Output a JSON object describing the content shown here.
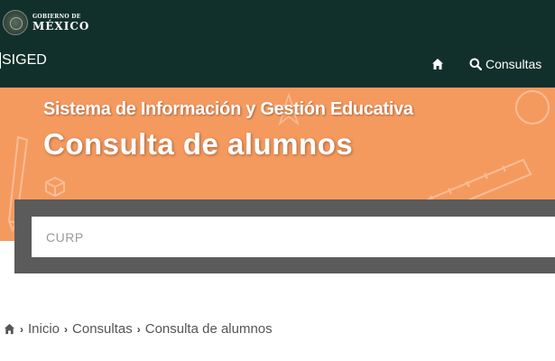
{
  "header": {
    "gov_small": "GOBIERNO DE",
    "gov_big": "MÉXICO",
    "app_name": "SIGED",
    "nav": {
      "home_icon": "home-icon",
      "consultas_icon": "search-icon",
      "consultas_label": "Consultas"
    }
  },
  "banner": {
    "subtitle": "Sistema de Información y Gestión Educativa",
    "title": "Consulta de alumnos"
  },
  "search": {
    "placeholder": "CURP",
    "value": ""
  },
  "breadcrumb": {
    "home_icon": "home-icon",
    "items": [
      "Inicio",
      "Consultas",
      "Consulta de alumnos"
    ]
  },
  "colors": {
    "header_bg": "#12302b",
    "banner_bg": "#f59a5f",
    "panel_bg": "#5b5b5b",
    "text_muted": "#555555"
  }
}
